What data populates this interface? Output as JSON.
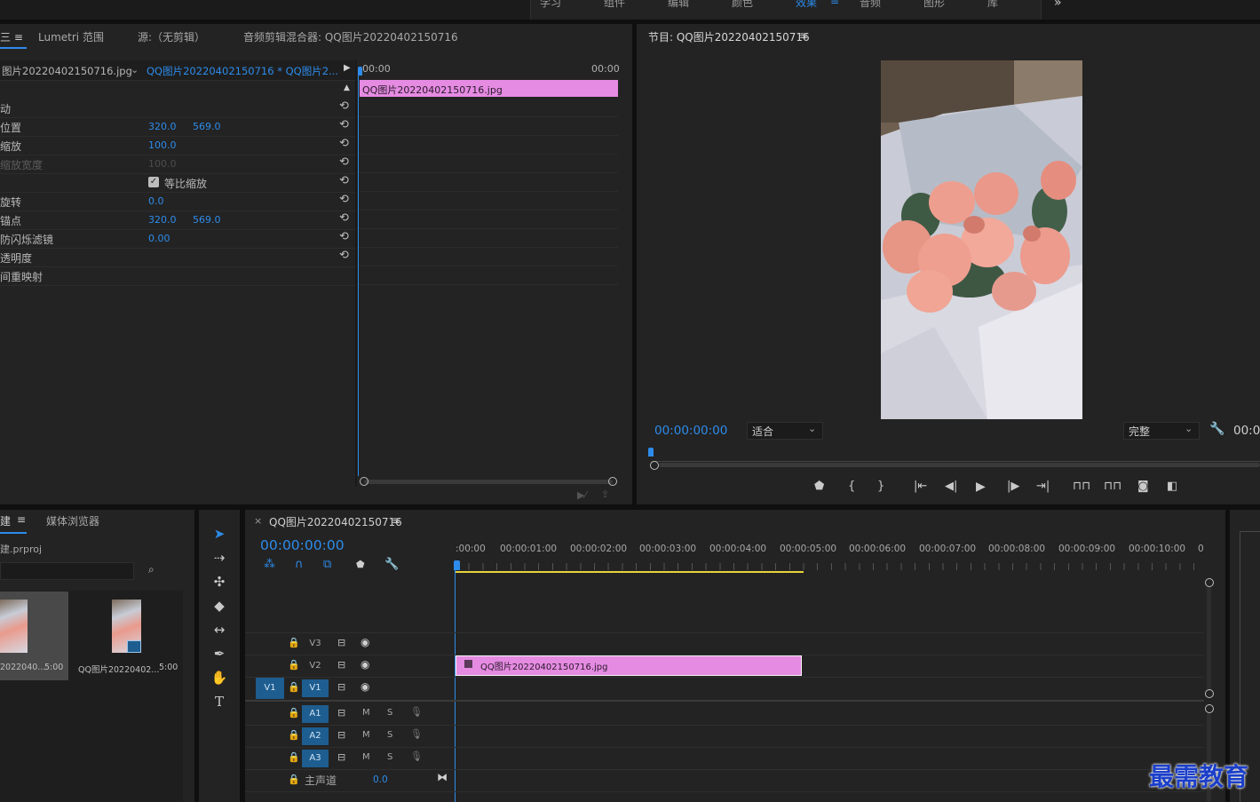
{
  "workspace": {
    "tabs": [
      "学习",
      "组件",
      "编辑",
      "颜色",
      "效果",
      "音频",
      "图形",
      "库"
    ],
    "active": "效果",
    "more_icon": "»"
  },
  "source_panel": {
    "tabs": [
      "Lumetri 范围",
      "源:（无剪辑）",
      "音频剪辑混合器: QQ图片20220402150716"
    ],
    "menu_icon": "≡"
  },
  "effect_controls": {
    "master_clip": "图片20220402150716.jpg",
    "sequence_clip": "QQ图片20220402150716 * QQ图片2...",
    "rows": [
      {
        "label": "动",
        "v1": "",
        "v2": ""
      },
      {
        "label": "位置",
        "v1": "320.0",
        "v2": "569.0"
      },
      {
        "label": "缩放",
        "v1": "100.0",
        "v2": ""
      },
      {
        "label": "缩放宽度",
        "v1": "100.0",
        "v2": "",
        "dim": true
      },
      {
        "label": "",
        "v1": "",
        "v2": "",
        "checkbox": "等比缩放"
      },
      {
        "label": "旋转",
        "v1": "0.0",
        "v2": ""
      },
      {
        "label": "锚点",
        "v1": "320.0",
        "v2": "569.0"
      },
      {
        "label": "防闪烁滤镜",
        "v1": "0.00",
        "v2": ""
      },
      {
        "label": "透明度",
        "v1": "",
        "v2": ""
      },
      {
        "label": "间重映射",
        "v1": "",
        "v2": ""
      }
    ],
    "mini_time_start": "00:00",
    "mini_time_end": "00:00",
    "mini_clip": "QQ图片20220402150716.jpg"
  },
  "program_monitor": {
    "title": "节目: QQ图片20220402150716",
    "timecode": "00:00:00:00",
    "fit": "适合",
    "quality": "完整",
    "end_timecode": "00:0"
  },
  "project_panel": {
    "tabs": [
      "建",
      "媒体浏览器"
    ],
    "project_file": "建.prproj",
    "items": [
      {
        "name": "2022040...",
        "duration": "5:00"
      },
      {
        "name": "QQ图片20220402...",
        "duration": "5:00"
      }
    ]
  },
  "timeline": {
    "title": "QQ图片20220402150716",
    "timecode": "00:00:00:00",
    "ruler": [
      ":00:00",
      "00:00:01:00",
      "00:00:02:00",
      "00:00:03:00",
      "00:00:04:00",
      "00:00:05:00",
      "00:00:06:00",
      "00:00:07:00",
      "00:00:08:00",
      "00:00:09:00",
      "00:00:10:00",
      "0"
    ],
    "tracks": {
      "video": [
        {
          "name": "V3",
          "target": ""
        },
        {
          "name": "V2",
          "target": ""
        },
        {
          "name": "V1",
          "target": "V1"
        }
      ],
      "audio": [
        {
          "name": "A1",
          "m": "M",
          "s": "S"
        },
        {
          "name": "A2",
          "m": "M",
          "s": "S"
        },
        {
          "name": "A3",
          "m": "M",
          "s": "S"
        }
      ],
      "master_label": "主声道",
      "master_value": "0.0"
    },
    "clip": "QQ图片20220402150716.jpg"
  },
  "watermark": "最需教育",
  "colors": {
    "accent": "#2d8ceb",
    "clip": "#e58be2",
    "panel": "#232323",
    "work_area": "#e8d53a"
  }
}
